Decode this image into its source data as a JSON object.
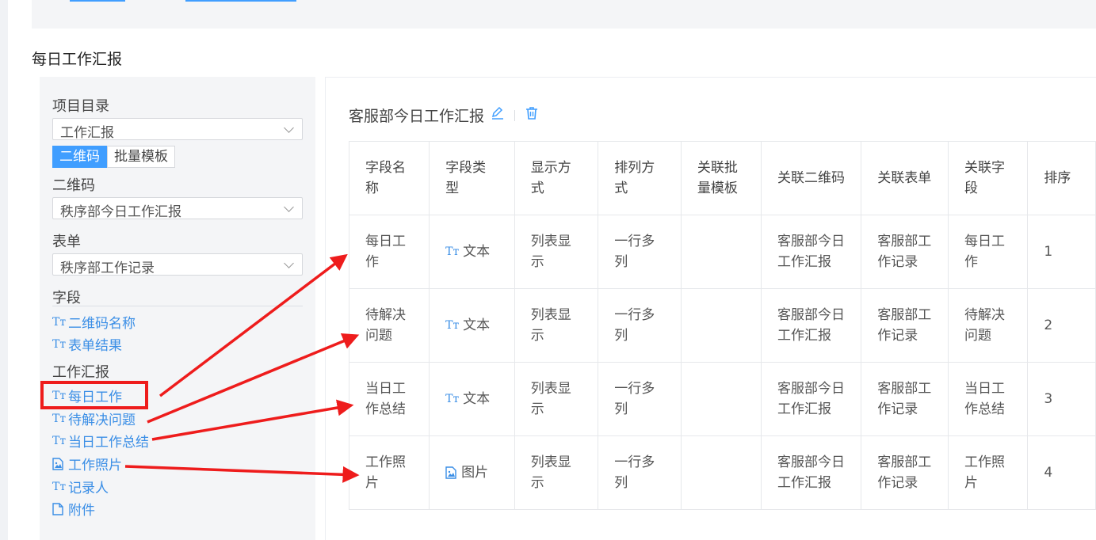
{
  "section_title": "每日工作汇报",
  "left": {
    "project_label": "项目目录",
    "project_value": "工作汇报",
    "tabs": [
      {
        "label": "二维码",
        "active": true
      },
      {
        "label": "批量模板",
        "active": false
      }
    ],
    "qr_label": "二维码",
    "qr_value": "秩序部今日工作汇报",
    "form_label": "表单",
    "form_value": "秩序部工作记录",
    "fields_label": "字段",
    "fields": [
      {
        "icon": "text-type-icon",
        "label": "二维码名称"
      },
      {
        "icon": "text-type-icon",
        "label": "表单结果"
      }
    ],
    "group_label": "工作汇报",
    "group_fields": [
      {
        "icon": "text-type-icon",
        "label": "每日工作"
      },
      {
        "icon": "text-type-icon",
        "label": "待解决问题"
      },
      {
        "icon": "text-type-icon",
        "label": "当日工作总结"
      },
      {
        "icon": "image-file-icon",
        "label": "工作照片"
      },
      {
        "icon": "text-type-icon",
        "label": "记录人"
      },
      {
        "icon": "file-icon",
        "label": "附件"
      }
    ]
  },
  "right": {
    "title": "客服部今日工作汇报",
    "columns": [
      "字段名称",
      "字段类型",
      "显示方式",
      "排列方式",
      "关联批量模板",
      "关联二维码",
      "关联表单",
      "关联字段",
      "排序"
    ],
    "rows": [
      {
        "name": "每日工作",
        "type_icon": "text-type-icon",
        "type": "文本",
        "display": "列表显示",
        "arrange": "一行多列",
        "batch": "",
        "qr": "客服部今日工作汇报",
        "form": "客服部工作记录",
        "field": "每日工作",
        "order": "1"
      },
      {
        "name": "待解决问题",
        "type_icon": "text-type-icon",
        "type": "文本",
        "display": "列表显示",
        "arrange": "一行多列",
        "batch": "",
        "qr": "客服部今日工作汇报",
        "form": "客服部工作记录",
        "field": "待解决问题",
        "order": "2"
      },
      {
        "name": "当日工作总结",
        "type_icon": "text-type-icon",
        "type": "文本",
        "display": "列表显示",
        "arrange": "一行多列",
        "batch": "",
        "qr": "客服部今日工作汇报",
        "form": "客服部工作记录",
        "field": "当日工作总结",
        "order": "3"
      },
      {
        "name": "工作照片",
        "type_icon": "image-file-icon",
        "type": "图片",
        "display": "列表显示",
        "arrange": "一行多列",
        "batch": "",
        "qr": "客服部今日工作汇报",
        "form": "客服部工作记录",
        "field": "工作照片",
        "order": "4"
      }
    ]
  },
  "colors": {
    "accent": "#409eff",
    "annotation": "#ee1c1c"
  }
}
